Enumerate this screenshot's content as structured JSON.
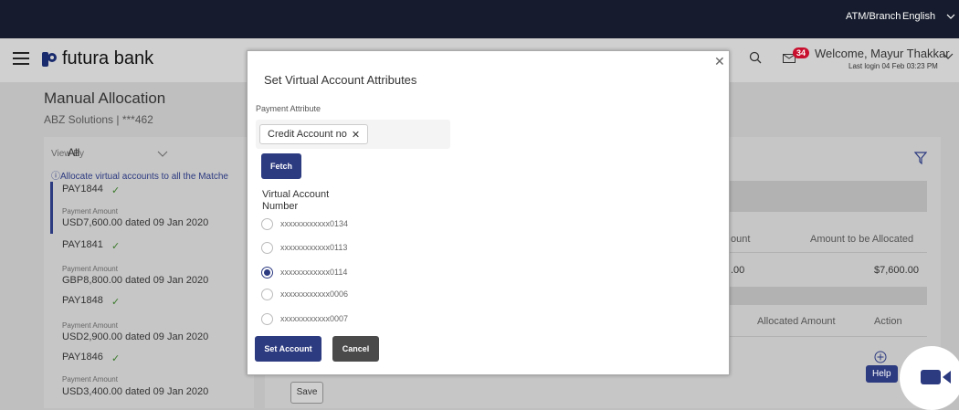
{
  "topbar": {
    "atm_branch": "ATM/Branch",
    "language": "English"
  },
  "header": {
    "brand": "futura bank",
    "badge": "34",
    "welcome": "Welcome, Mayur Thakkar",
    "last_login": "Last login 04 Feb 03:23 PM"
  },
  "page": {
    "title": "Manual Allocation",
    "subtitle": "ABZ Solutions | ***462"
  },
  "left": {
    "view_by_label": "View By",
    "view_by_value": "All",
    "info": "ⓘAllocate virtual accounts to all the Matche",
    "payments": [
      {
        "id": "PAY1844",
        "label": "Payment Amount",
        "value": "USD7,600.00 dated 09 Jan 2020"
      },
      {
        "id": "PAY1841",
        "label": "Payment Amount",
        "value": "GBP8,800.00 dated 09 Jan 2020"
      },
      {
        "id": "PAY1848",
        "label": "Payment Amount",
        "value": "USD2,900.00 dated 09 Jan 2020"
      },
      {
        "id": "PAY1846",
        "label": "Payment Amount",
        "value": "USD3,400.00 dated 09 Jan 2020"
      }
    ]
  },
  "main": {
    "col_amount_partial": "ount",
    "col_to_allocate": "Amount to be Allocated",
    "amount_partial": ".00",
    "to_allocate_value": "$7,600.00",
    "col_allocated": "Allocated Amount",
    "col_action": "Action",
    "save": "Save",
    "help": "Help"
  },
  "modal": {
    "title": "Set Virtual Account Attributes",
    "payment_attribute_label": "Payment Attribute",
    "chip": "Credit Account no",
    "fetch": "Fetch",
    "va_label": "Virtual Account Number",
    "accounts": [
      "xxxxxxxxxxxx0134",
      "xxxxxxxxxxxx0113",
      "xxxxxxxxxxxx0114",
      "xxxxxxxxxxxx0006",
      "xxxxxxxxxxxx0007"
    ],
    "selected_account": "xxxxxxxxxxxx0114",
    "set_account": "Set Account",
    "cancel": "Cancel"
  },
  "colors": {
    "primary": "#2c3a80",
    "topbar": "#161c2d",
    "badge": "#c8102e"
  }
}
